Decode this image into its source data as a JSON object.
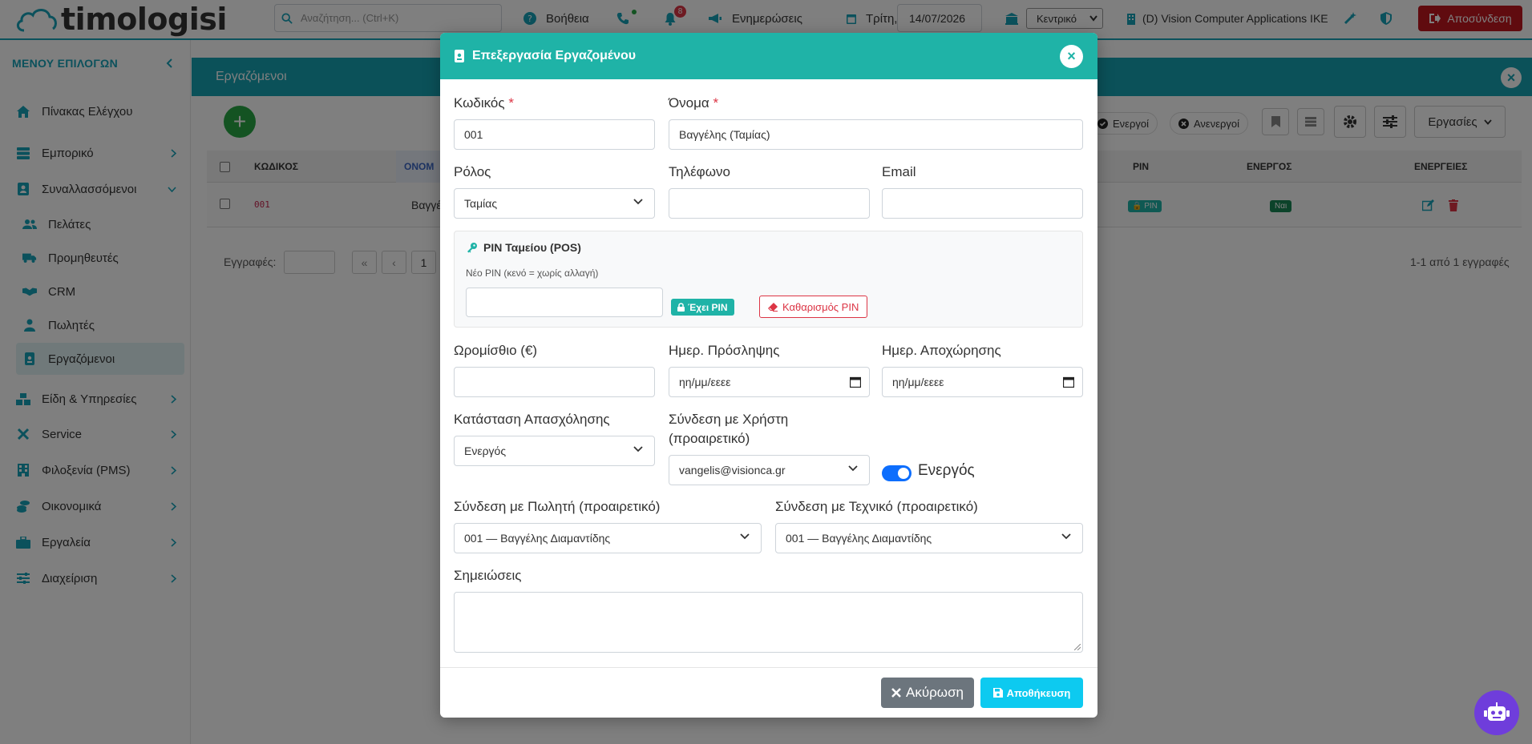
{
  "app": {
    "logo_text": "timologisi"
  },
  "topbar": {
    "search_placeholder": "Αναζήτηση... (Ctrl+K)",
    "help_label": "Βοήθεια",
    "notif_count": "8",
    "news_label": "Ενημερώσεις",
    "day_label": "Τρίτη,",
    "date_value": "14/07/2026",
    "branch_value": "Κεντρικό",
    "company_name": "(D) Vision Computer Applications IKE",
    "logout_label": "Αποσύνδεση"
  },
  "sidebar": {
    "header": "ΜΕΝΟΥ ΕΠΙΛΟΓΩΝ",
    "items": [
      {
        "label": "Πίνακας Ελέγχου"
      },
      {
        "label": "Εμπορικό"
      },
      {
        "label": "Συναλλασσόμενοι"
      },
      {
        "label": "Πελάτες"
      },
      {
        "label": "Προμηθευτές"
      },
      {
        "label": "CRM"
      },
      {
        "label": "Πωλητές"
      },
      {
        "label": "Εργαζόμενοι"
      },
      {
        "label": "Είδη & Υπηρεσίες"
      },
      {
        "label": "Service"
      },
      {
        "label": "Φιλοξενία (PMS)"
      },
      {
        "label": "Οικονομικά"
      },
      {
        "label": "Εργαλεία"
      },
      {
        "label": "Διαχείριση"
      }
    ]
  },
  "page": {
    "title": "Εργαζόμενοι",
    "filter_active": "Ενεργοί",
    "filter_inactive": "Ανενεργοί",
    "actions_label": "Εργασίες",
    "columns": [
      "ΚΩΔΙΚΟΣ",
      "ΟΝΟΜ",
      "PIN",
      "ΕΝΕΡΓΟΣ",
      "ΕΝΕΡΓΕΙΕΣ"
    ],
    "row": {
      "code": "001",
      "name": "Βαγγέ",
      "pin_badge": "PIN",
      "active_badge": "Ναι"
    },
    "records_label": "Εγγραφές:",
    "page_num": "1",
    "records_info": "1-1 από 1 εγγραφές"
  },
  "modal": {
    "title": "Επεξεργασία Εργαζομένου",
    "code_label": "Κωδικός",
    "code_value": "001",
    "name_label": "Όνομα",
    "name_value": "Βαγγέλης (Ταμίας)",
    "role_label": "Ρόλος",
    "role_value": "Ταμίας",
    "phone_label": "Τηλέφωνο",
    "email_label": "Email",
    "pin_title": "PIN Ταμείου (POS)",
    "pin_sub": "Νέο PIN (κενό = χωρίς αλλαγή)",
    "has_pin": "Έχει PIN",
    "clear_pin": "Καθαρισμός PIN",
    "wage_label": "Ωρομίσθιο (€)",
    "hire_label": "Ημερ. Πρόσληψης",
    "hire_placeholder": "ηη/μμ/εεεε",
    "leave_label": "Ημερ. Αποχώρησης",
    "leave_placeholder": "ηη/μμ/εεεε",
    "status_label": "Κατάσταση Απασχόλησης",
    "status_value": "Ενεργός",
    "user_label_1": "Σύνδεση με Χρήστη",
    "user_label_2": "(προαιρετικό)",
    "user_value": "vangelis@visionca.gr",
    "active_toggle_label": "Ενεργός",
    "seller_label": "Σύνδεση με Πωλητή (προαιρετικό)",
    "seller_value": "001 — Βαγγέλης Διαμαντίδης",
    "tech_label": "Σύνδεση με Τεχνικό (προαιρετικό)",
    "tech_value": "001 — Βαγγέλης Διαμαντίδης",
    "notes_label": "Σημειώσεις",
    "cancel_label": "Ακύρωση",
    "save_label": "Αποθήκευση"
  },
  "colors": {
    "teal": "#1fb3a7",
    "accent": "#17a2b8",
    "danger": "#c0171f"
  }
}
